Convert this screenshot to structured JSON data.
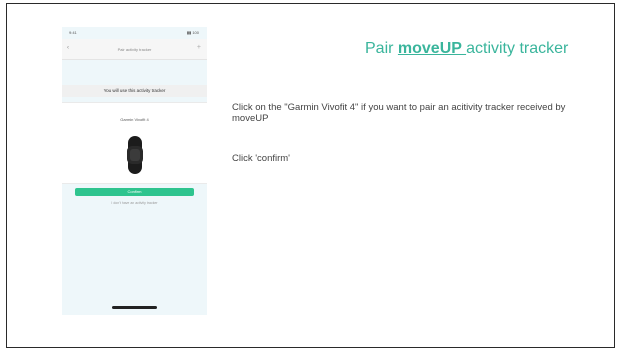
{
  "slide": {
    "title_prefix": "Pair ",
    "title_brand": "moveUP ",
    "title_suffix": "activity tracker",
    "instruction_1": "Click on the \"Garmin Vivofit 4\" if you want to pair an acitivity tracker received by moveUP",
    "instruction_2": "Click 'confirm'"
  },
  "phone": {
    "status_time": "9:41",
    "status_battery": "▮▮ 100",
    "nav_back": "‹",
    "nav_title": "Pair activity tracker",
    "nav_add": "+",
    "device_heading": "You will use this activity tracker",
    "device_name": "Garmin Vivofit 4",
    "confirm_label": "Confirm",
    "help_text": "I don't have an activity tracker"
  },
  "colors": {
    "accent": "#3ab59c",
    "button": "#2ec48e"
  }
}
